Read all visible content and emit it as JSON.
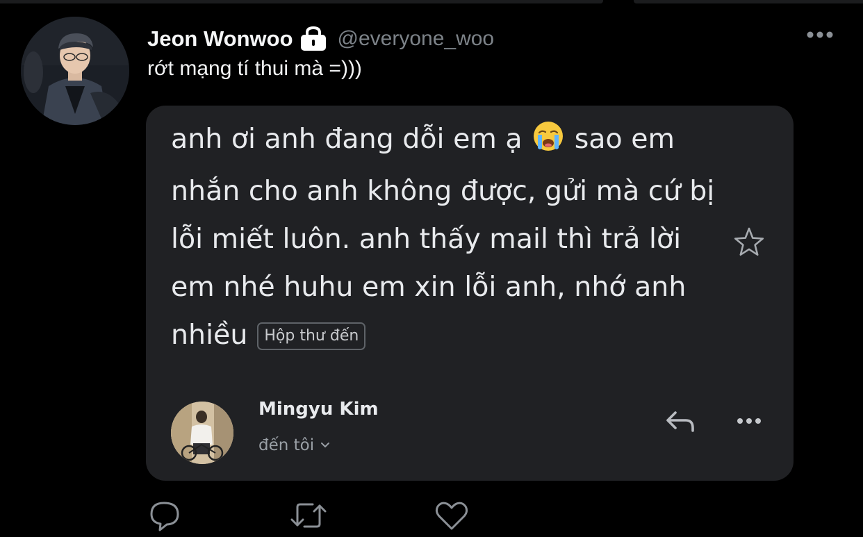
{
  "tweet": {
    "author_name": "Jeon Wonwoo",
    "author_handle": "@everyone_woo",
    "text": "rớt mạng tí thui mà =)))",
    "protected_icon": "lock-icon",
    "more_icon": "more-horizontal-icon"
  },
  "email_card": {
    "body_before_emoji": "anh ơi anh đang dỗi em ạ ",
    "emoji": "loudly-crying-face-emoji",
    "body_after_emoji": " sao em nhắn cho anh không được, gửi mà cứ bị lỗi miết luôn. anh thấy mail thì trả lời em nhé huhu em xin lỗi anh, nhớ anh nhiều",
    "label_chip": "Hộp thư đến",
    "star_icon": "star-outline-icon",
    "sender_name": "Mingyu Kim",
    "recipient": "đến tôi",
    "reply_icon": "reply-icon",
    "more_icon": "more-horizontal-icon"
  },
  "tweet_actions": [
    "reply-icon",
    "retweet-icon",
    "like-icon"
  ],
  "colors": {
    "background": "#000000",
    "card_background": "#202124",
    "handle_gray": "#7d8389",
    "text_white": "#e8eaed",
    "secondary_gray": "#9aa0a6"
  }
}
